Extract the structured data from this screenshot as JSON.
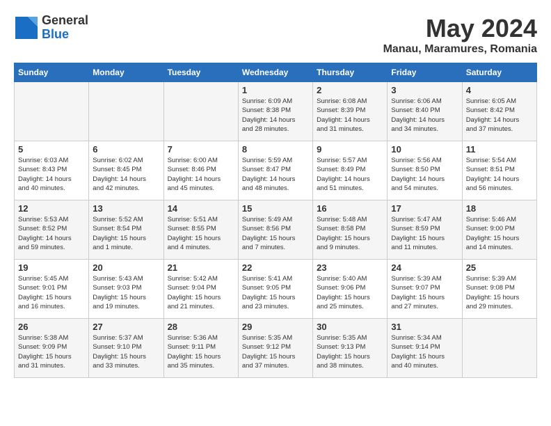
{
  "logo": {
    "general": "General",
    "blue": "Blue"
  },
  "header": {
    "title": "May 2024",
    "location": "Manau, Maramures, Romania"
  },
  "weekdays": [
    "Sunday",
    "Monday",
    "Tuesday",
    "Wednesday",
    "Thursday",
    "Friday",
    "Saturday"
  ],
  "weeks": [
    [
      {
        "day": "",
        "info": ""
      },
      {
        "day": "",
        "info": ""
      },
      {
        "day": "",
        "info": ""
      },
      {
        "day": "1",
        "info": "Sunrise: 6:09 AM\nSunset: 8:38 PM\nDaylight: 14 hours\nand 28 minutes."
      },
      {
        "day": "2",
        "info": "Sunrise: 6:08 AM\nSunset: 8:39 PM\nDaylight: 14 hours\nand 31 minutes."
      },
      {
        "day": "3",
        "info": "Sunrise: 6:06 AM\nSunset: 8:40 PM\nDaylight: 14 hours\nand 34 minutes."
      },
      {
        "day": "4",
        "info": "Sunrise: 6:05 AM\nSunset: 8:42 PM\nDaylight: 14 hours\nand 37 minutes."
      }
    ],
    [
      {
        "day": "5",
        "info": "Sunrise: 6:03 AM\nSunset: 8:43 PM\nDaylight: 14 hours\nand 40 minutes."
      },
      {
        "day": "6",
        "info": "Sunrise: 6:02 AM\nSunset: 8:45 PM\nDaylight: 14 hours\nand 42 minutes."
      },
      {
        "day": "7",
        "info": "Sunrise: 6:00 AM\nSunset: 8:46 PM\nDaylight: 14 hours\nand 45 minutes."
      },
      {
        "day": "8",
        "info": "Sunrise: 5:59 AM\nSunset: 8:47 PM\nDaylight: 14 hours\nand 48 minutes."
      },
      {
        "day": "9",
        "info": "Sunrise: 5:57 AM\nSunset: 8:49 PM\nDaylight: 14 hours\nand 51 minutes."
      },
      {
        "day": "10",
        "info": "Sunrise: 5:56 AM\nSunset: 8:50 PM\nDaylight: 14 hours\nand 54 minutes."
      },
      {
        "day": "11",
        "info": "Sunrise: 5:54 AM\nSunset: 8:51 PM\nDaylight: 14 hours\nand 56 minutes."
      }
    ],
    [
      {
        "day": "12",
        "info": "Sunrise: 5:53 AM\nSunset: 8:52 PM\nDaylight: 14 hours\nand 59 minutes."
      },
      {
        "day": "13",
        "info": "Sunrise: 5:52 AM\nSunset: 8:54 PM\nDaylight: 15 hours\nand 1 minute."
      },
      {
        "day": "14",
        "info": "Sunrise: 5:51 AM\nSunset: 8:55 PM\nDaylight: 15 hours\nand 4 minutes."
      },
      {
        "day": "15",
        "info": "Sunrise: 5:49 AM\nSunset: 8:56 PM\nDaylight: 15 hours\nand 7 minutes."
      },
      {
        "day": "16",
        "info": "Sunrise: 5:48 AM\nSunset: 8:58 PM\nDaylight: 15 hours\nand 9 minutes."
      },
      {
        "day": "17",
        "info": "Sunrise: 5:47 AM\nSunset: 8:59 PM\nDaylight: 15 hours\nand 11 minutes."
      },
      {
        "day": "18",
        "info": "Sunrise: 5:46 AM\nSunset: 9:00 PM\nDaylight: 15 hours\nand 14 minutes."
      }
    ],
    [
      {
        "day": "19",
        "info": "Sunrise: 5:45 AM\nSunset: 9:01 PM\nDaylight: 15 hours\nand 16 minutes."
      },
      {
        "day": "20",
        "info": "Sunrise: 5:43 AM\nSunset: 9:03 PM\nDaylight: 15 hours\nand 19 minutes."
      },
      {
        "day": "21",
        "info": "Sunrise: 5:42 AM\nSunset: 9:04 PM\nDaylight: 15 hours\nand 21 minutes."
      },
      {
        "day": "22",
        "info": "Sunrise: 5:41 AM\nSunset: 9:05 PM\nDaylight: 15 hours\nand 23 minutes."
      },
      {
        "day": "23",
        "info": "Sunrise: 5:40 AM\nSunset: 9:06 PM\nDaylight: 15 hours\nand 25 minutes."
      },
      {
        "day": "24",
        "info": "Sunrise: 5:39 AM\nSunset: 9:07 PM\nDaylight: 15 hours\nand 27 minutes."
      },
      {
        "day": "25",
        "info": "Sunrise: 5:39 AM\nSunset: 9:08 PM\nDaylight: 15 hours\nand 29 minutes."
      }
    ],
    [
      {
        "day": "26",
        "info": "Sunrise: 5:38 AM\nSunset: 9:09 PM\nDaylight: 15 hours\nand 31 minutes."
      },
      {
        "day": "27",
        "info": "Sunrise: 5:37 AM\nSunset: 9:10 PM\nDaylight: 15 hours\nand 33 minutes."
      },
      {
        "day": "28",
        "info": "Sunrise: 5:36 AM\nSunset: 9:11 PM\nDaylight: 15 hours\nand 35 minutes."
      },
      {
        "day": "29",
        "info": "Sunrise: 5:35 AM\nSunset: 9:12 PM\nDaylight: 15 hours\nand 37 minutes."
      },
      {
        "day": "30",
        "info": "Sunrise: 5:35 AM\nSunset: 9:13 PM\nDaylight: 15 hours\nand 38 minutes."
      },
      {
        "day": "31",
        "info": "Sunrise: 5:34 AM\nSunset: 9:14 PM\nDaylight: 15 hours\nand 40 minutes."
      },
      {
        "day": "",
        "info": ""
      }
    ]
  ]
}
